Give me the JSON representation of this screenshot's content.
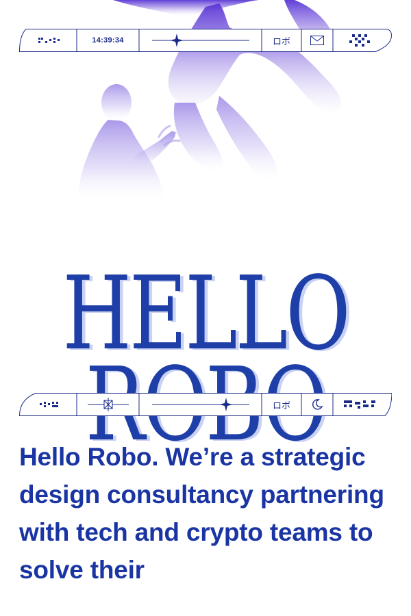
{
  "top_bar": {
    "clock": "14:39:34",
    "jp_label": "ロボ",
    "icons": [
      "braille-pattern-icon",
      "sparkle-line-icon",
      "mail-icon",
      "diamond-grid-logo-icon"
    ]
  },
  "hero": {
    "title_line1": "HELLO",
    "title_line2": "ROBO"
  },
  "bottom_bar": {
    "jp_label": "ロボ",
    "icons": [
      "braille-pattern-icon",
      "crossed-box-icon",
      "sparkle-line-icon",
      "moon-icon",
      "pixel-pattern-icon"
    ]
  },
  "intro": {
    "text": "Hello Robo. We’re a strategic design consultancy partnering with tech and crypto teams to solve their"
  },
  "colors": {
    "brand_blue": "#1a35a3",
    "shadow_blue": "#c9d2f2",
    "hero_purple": "#6a4fd8"
  }
}
